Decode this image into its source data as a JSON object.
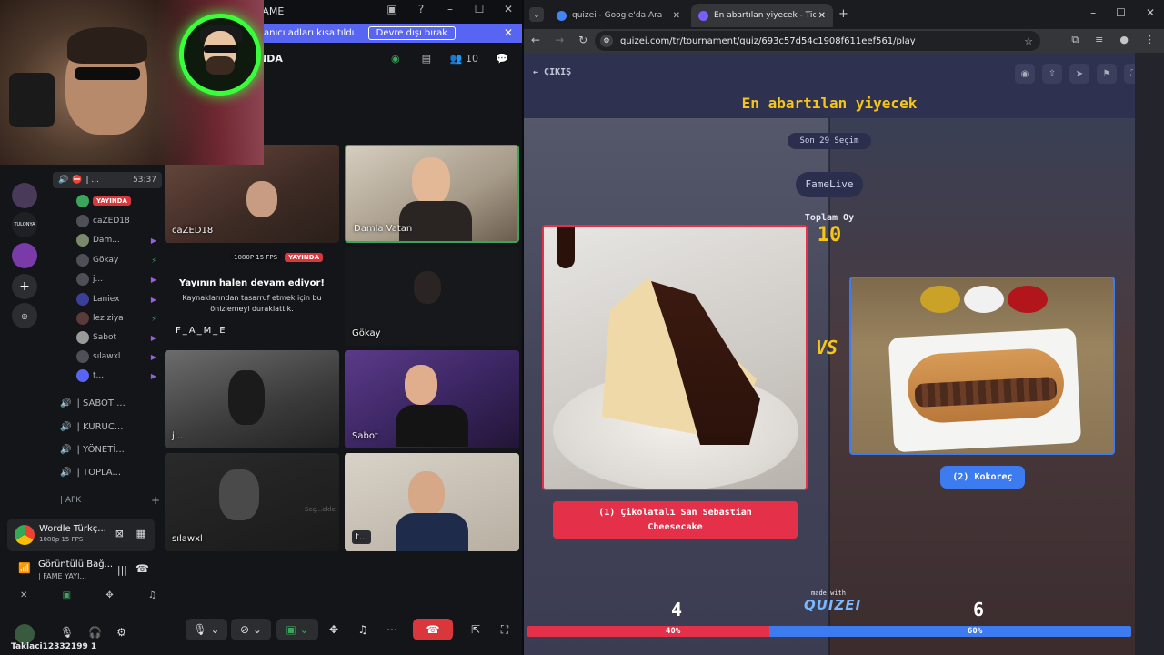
{
  "discord": {
    "app_title": "FAME",
    "banner": {
      "text": "anıcı adları kısaltıldı.",
      "button": "Devre dışı bırak"
    },
    "channel_title": "NDA",
    "member_count": "10",
    "voice_header": {
      "label": "| ...",
      "time": "53:37"
    },
    "members": [
      {
        "name": "YAYINDA",
        "live": true
      },
      {
        "name": "caZED18"
      },
      {
        "name": "Dam..."
      },
      {
        "name": "Gökay"
      },
      {
        "name": "j..."
      },
      {
        "name": "Laniex"
      },
      {
        "name": "lez ziya"
      },
      {
        "name": "Sabot"
      },
      {
        "name": "sılawxl"
      },
      {
        "name": "t..."
      }
    ],
    "channels": [
      "| SABOT ...",
      "| KURUC...",
      "| YÖNETİ...",
      "| TOPLA..."
    ],
    "afk_label": "| AFK |",
    "server_label": "TULONYA",
    "activity": {
      "title": "Wordle Türkç...",
      "subtitle": "1080p 15 FPS"
    },
    "voice_status": {
      "title": "Görüntülü Bağ...",
      "subtitle": "| FAME YAYI..."
    },
    "user": {
      "name": "Taklaci12332199",
      "tag": "1"
    },
    "tiles": [
      {
        "name": "caZED18"
      },
      {
        "name": "Damla Vatan"
      },
      {
        "name": "Gökay"
      },
      {
        "name": "j..."
      },
      {
        "name": "Sabot"
      },
      {
        "name": "sılawxl"
      },
      {
        "name": "t..."
      }
    ],
    "stream": {
      "fps": "1080P 15 FPS",
      "live": "YAYINDA",
      "heading": "Yayının halen devam ediyor!",
      "paragraph": "Kaynaklarından tasarruf etmek için bu önizlemeyi duraklattık.",
      "name": "F_A_M_E"
    },
    "tile_overlay": "Seç...ekle"
  },
  "chrome": {
    "tabs": [
      {
        "title": "quizei - Google'da Ara",
        "color": "#4285f4"
      },
      {
        "title": "En abartılan yiyecek - Tier List, ...",
        "color": "#7b5cff"
      }
    ],
    "url": "quizei.com/tr/tournament/quiz/693c57d54c1908f611eef561/play"
  },
  "quiz": {
    "back_label": "ÇIKIŞ",
    "title": "En abartılan yiyecek",
    "round": "Son 29 Seçim",
    "streamer": "FameLive",
    "total_label": "Toplam Oy",
    "total_votes": "10",
    "vs": "VS",
    "option1": {
      "label": "(1) Çikolatalı San Sebastian Cheesecake",
      "votes": "4",
      "percent": "40%",
      "share": 0.4,
      "color": "#e5304a"
    },
    "option2": {
      "label": "(2) Kokoreç",
      "votes": "6",
      "percent": "60%",
      "share": 0.6,
      "color": "#3d7bf0"
    },
    "made_with": "made with",
    "brand": "QUIZEI"
  }
}
